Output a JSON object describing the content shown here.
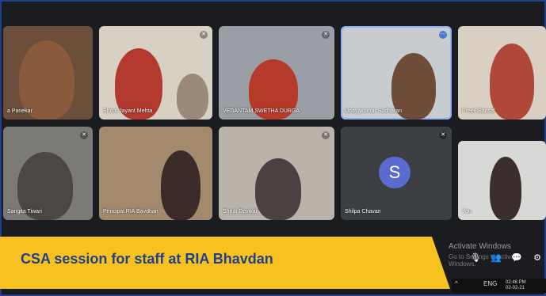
{
  "participants": [
    {
      "name": "a Panekar"
    },
    {
      "name": "Shruti Jayant Mehta"
    },
    {
      "name": "VEDANTAM SWETHA DURGA"
    },
    {
      "name": "Udayakumar Sudharan"
    },
    {
      "name": "Preeti Bansal"
    },
    {
      "name": "Sangita Tiwari"
    },
    {
      "name": "Principal RIA Bavdhan"
    },
    {
      "name": "Shruti Devikar"
    },
    {
      "name": "Shilpa Chavan",
      "initial": "S"
    },
    {
      "name": "You"
    }
  ],
  "banner": {
    "text": "CSA session for staff at RIA Bhavdan"
  },
  "watermark": {
    "title": "Activate Windows",
    "subtitle": "Go to Settings to activate Windows."
  },
  "controls": {
    "more": "⋯",
    "mic": "🎙",
    "people": "👥",
    "chat": "💬",
    "activities": "⚙"
  },
  "taskbar": {
    "lang": "ENG",
    "time": "02:46 PM",
    "date": "02-02-21"
  },
  "colors": {
    "banner": "#f7c21f",
    "banner_text": "#1f3f8f",
    "avatar": "#5b6bd0",
    "active_outline": "#8ab4f8"
  }
}
